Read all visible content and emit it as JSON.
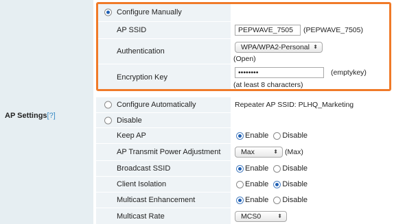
{
  "section": {
    "label": "AP Settings",
    "help": "[?]"
  },
  "configure_manually": {
    "label": "Configure Manually"
  },
  "ap_ssid": {
    "label": "AP SSID",
    "value": "PEPWAVE_7505",
    "hint": "(PEPWAVE_7505)"
  },
  "authentication": {
    "label": "Authentication",
    "selected": "WPA/WPA2-Personal",
    "hint": "(Open)"
  },
  "encryption_key": {
    "label": "Encryption Key",
    "value": "••••••••",
    "hint": "(emptykey)",
    "note": "(at least 8 characters)"
  },
  "configure_automatically": {
    "label": "Configure Automatically",
    "info": "Repeater AP SSID: PLHQ_Marketing"
  },
  "disable": {
    "label": "Disable"
  },
  "options": {
    "enable": "Enable",
    "disable": "Disable"
  },
  "keep_ap": {
    "label": "Keep AP",
    "selected": "Enable"
  },
  "tx_power": {
    "label": "AP Transmit Power Adjustment",
    "selected": "Max",
    "hint": "(Max)"
  },
  "broadcast_ssid": {
    "label": "Broadcast SSID",
    "selected": "Enable"
  },
  "client_isolation": {
    "label": "Client Isolation",
    "selected": "Disable"
  },
  "multicast_enhancement": {
    "label": "Multicast Enhancement",
    "selected": "Enable"
  },
  "multicast_rate": {
    "label": "Multicast Rate",
    "selected": "MCS0"
  },
  "colors": {
    "highlight": "#f07a28",
    "accent": "#1e5fb4",
    "row_bg": "#eef3f6",
    "label_bg": "#e6eef2"
  }
}
